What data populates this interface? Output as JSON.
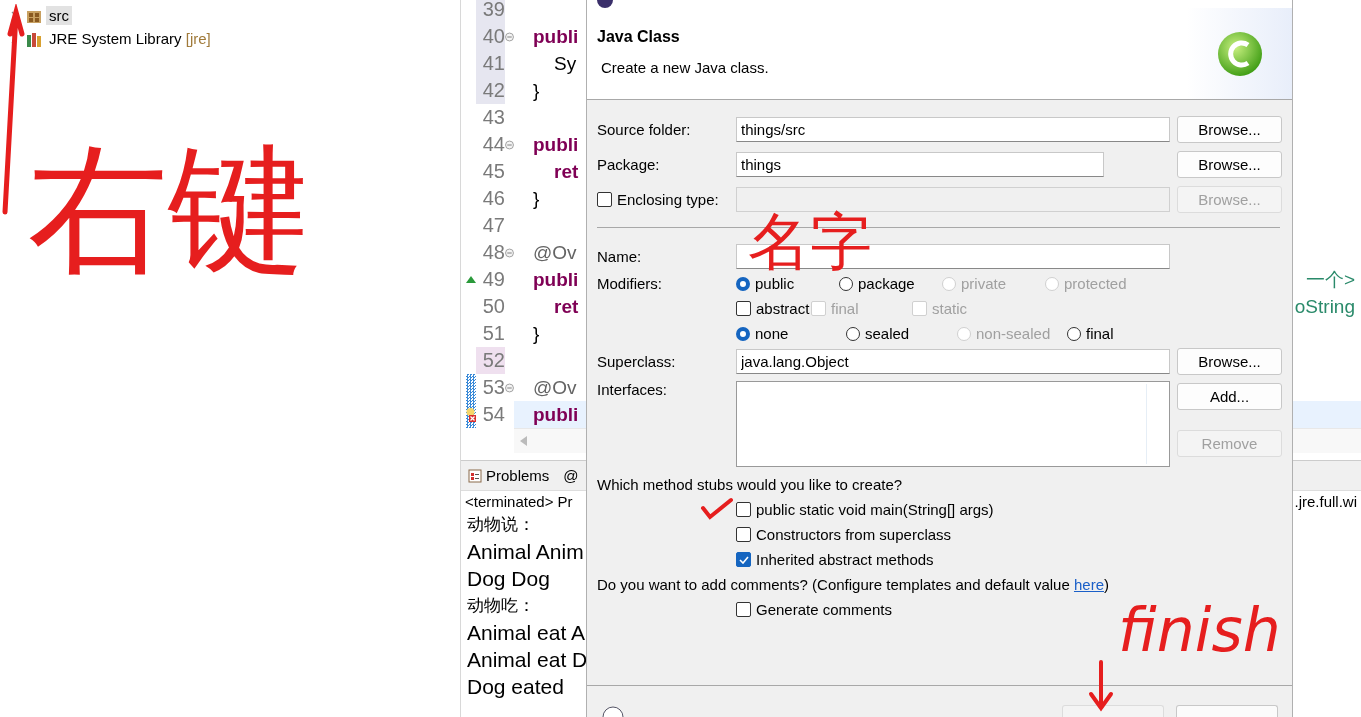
{
  "project_tree": {
    "items": [
      {
        "label": "src",
        "kind": "package",
        "selected": true
      },
      {
        "label": "JRE System Library",
        "suffix": "[jre]",
        "kind": "library",
        "selected": false
      }
    ]
  },
  "editor": {
    "lines": [
      {
        "number": "39",
        "shaded": true,
        "modified": false,
        "changed": false,
        "override": false,
        "error": false,
        "fold": false,
        "current": false
      },
      {
        "number": "40",
        "shaded": true,
        "modified": false,
        "changed": false,
        "override": false,
        "error": false,
        "fold": true,
        "current": false,
        "tokens": [
          {
            "kind": "keyword",
            "text": "publi"
          }
        ]
      },
      {
        "number": "41",
        "shaded": true,
        "modified": false,
        "changed": false,
        "override": false,
        "error": false,
        "fold": false,
        "current": false,
        "tokens": [
          {
            "kind": "plain",
            "text": "    Sy"
          }
        ]
      },
      {
        "number": "42",
        "shaded": true,
        "modified": false,
        "changed": false,
        "override": false,
        "error": false,
        "fold": false,
        "current": false,
        "tokens": [
          {
            "kind": "plain",
            "text": "}"
          }
        ]
      },
      {
        "number": "43",
        "shaded": false,
        "modified": false,
        "changed": false,
        "override": false,
        "error": false,
        "fold": false,
        "current": false
      },
      {
        "number": "44",
        "shaded": false,
        "modified": false,
        "changed": false,
        "override": false,
        "error": false,
        "fold": true,
        "current": false,
        "tokens": [
          {
            "kind": "keyword",
            "text": "publi"
          }
        ]
      },
      {
        "number": "45",
        "shaded": false,
        "modified": false,
        "changed": false,
        "override": false,
        "error": false,
        "fold": false,
        "current": false,
        "tokens": [
          {
            "kind": "keyword",
            "text": "    ret"
          }
        ]
      },
      {
        "number": "46",
        "shaded": false,
        "modified": false,
        "changed": false,
        "override": false,
        "error": false,
        "fold": false,
        "current": false,
        "tokens": [
          {
            "kind": "plain",
            "text": "}"
          }
        ]
      },
      {
        "number": "47",
        "shaded": false,
        "modified": false,
        "changed": false,
        "override": false,
        "error": false,
        "fold": false,
        "current": false
      },
      {
        "number": "48",
        "shaded": false,
        "modified": false,
        "changed": false,
        "override": false,
        "error": false,
        "fold": true,
        "current": false,
        "tokens": [
          {
            "kind": "annotation",
            "text": "@Ov"
          }
        ]
      },
      {
        "number": "49",
        "shaded": false,
        "modified": false,
        "changed": false,
        "override": true,
        "error": false,
        "fold": false,
        "current": false,
        "tokens": [
          {
            "kind": "keyword",
            "text": "publi"
          }
        ],
        "tail": "一个>"
      },
      {
        "number": "50",
        "shaded": false,
        "modified": false,
        "changed": false,
        "override": false,
        "error": false,
        "fold": false,
        "current": false,
        "tokens": [
          {
            "kind": "keyword",
            "text": "    ret"
          }
        ],
        "tail": "oString"
      },
      {
        "number": "51",
        "shaded": false,
        "modified": false,
        "changed": false,
        "override": false,
        "error": false,
        "fold": false,
        "current": false,
        "tokens": [
          {
            "kind": "plain",
            "text": "}"
          }
        ]
      },
      {
        "number": "52",
        "shaded": false,
        "modified": true,
        "changed": false,
        "override": false,
        "error": false,
        "fold": false,
        "current": false
      },
      {
        "number": "53",
        "shaded": false,
        "modified": false,
        "changed": true,
        "override": false,
        "error": false,
        "fold": true,
        "current": false,
        "tokens": [
          {
            "kind": "annotation",
            "text": "@Ov"
          }
        ]
      },
      {
        "number": "54",
        "shaded": false,
        "modified": false,
        "changed": true,
        "override": false,
        "error": true,
        "fold": false,
        "current": true,
        "tokens": [
          {
            "kind": "keyword",
            "text": "publi"
          }
        ]
      }
    ]
  },
  "console": {
    "tabs": [
      {
        "label": "Problems",
        "selected": false
      },
      {
        "label": "@",
        "selected": false
      }
    ],
    "header_left": "<terminated> Pr",
    "header_right": ".jre.full.wi",
    "output": [
      {
        "kind": "cjk",
        "text": "动物说："
      },
      {
        "kind": "latin",
        "text": "Animal Anim"
      },
      {
        "kind": "latin",
        "text": "Dog Dog"
      },
      {
        "kind": "cjk",
        "text": "动物吃："
      },
      {
        "kind": "latin",
        "text": "Animal eat A"
      },
      {
        "kind": "latin",
        "text": "Animal eat D"
      },
      {
        "kind": "latin",
        "text": "Dog eated"
      }
    ]
  },
  "dialog": {
    "title": "Java Class",
    "subtitle": "Create a new Java class.",
    "location_rows": [
      {
        "kind": "plain",
        "label": "Source folder:",
        "value": "things/src",
        "disabled": false,
        "button": {
          "label": "Browse...",
          "disabled": false
        }
      },
      {
        "kind": "plain",
        "label": "Package:",
        "value": "things",
        "disabled": false,
        "button": {
          "label": "Browse...",
          "disabled": false
        }
      },
      {
        "kind": "checkbox",
        "label": "Enclosing type:",
        "checked": false,
        "disabled": true,
        "button": {
          "label": "Browse...",
          "disabled": true
        }
      }
    ],
    "name_label": "Name:",
    "modifiers": {
      "label": "Modifiers:",
      "rows": [
        [
          {
            "kind": "radio",
            "label": "public",
            "selected": true,
            "disabled": false
          },
          {
            "kind": "radio",
            "label": "package",
            "selected": false,
            "disabled": false
          },
          {
            "kind": "radio",
            "label": "private",
            "selected": false,
            "disabled": true
          },
          {
            "kind": "radio",
            "label": "protected",
            "selected": false,
            "disabled": true
          }
        ],
        [
          {
            "kind": "checkbox",
            "label": "abstract",
            "checked": false,
            "disabled": false
          },
          {
            "kind": "checkbox",
            "label": "final",
            "checked": false,
            "disabled": true
          },
          {
            "kind": "checkbox",
            "label": "static",
            "checked": false,
            "disabled": true
          }
        ],
        [
          {
            "kind": "radio",
            "label": "none",
            "selected": true,
            "disabled": false
          },
          {
            "kind": "radio",
            "label": "sealed",
            "selected": false,
            "disabled": false
          },
          {
            "kind": "radio",
            "label": "non-sealed",
            "selected": false,
            "disabled": true
          },
          {
            "kind": "radio",
            "label": "final",
            "selected": false,
            "disabled": false
          }
        ]
      ]
    },
    "superclass": {
      "label": "Superclass:",
      "value": "java.lang.Object",
      "button": {
        "label": "Browse...",
        "disabled": false
      }
    },
    "interfaces": {
      "label": "Interfaces:",
      "buttons": [
        {
          "label": "Add...",
          "disabled": false
        },
        {
          "label": "Remove",
          "disabled": true
        }
      ]
    },
    "stubs": {
      "question": "Which method stubs would you like to create?",
      "options": [
        {
          "label": "public static void main(String[] args)",
          "checked": false
        },
        {
          "label": "Constructors from superclass",
          "checked": false
        },
        {
          "label": "Inherited abstract methods",
          "checked": true
        }
      ]
    },
    "comments": {
      "question": "Do you want to add comments? (Configure templates and default value ",
      "link": "here",
      "question_end": ")",
      "options": [
        {
          "label": "Generate comments",
          "checked": false
        }
      ]
    }
  },
  "annotations": [
    {
      "kind": "arrow_up"
    },
    {
      "kind": "text",
      "text": "右键"
    },
    {
      "kind": "text",
      "text": "名字"
    },
    {
      "kind": "check"
    },
    {
      "kind": "text",
      "text": "finish"
    },
    {
      "kind": "arrow_down"
    }
  ]
}
